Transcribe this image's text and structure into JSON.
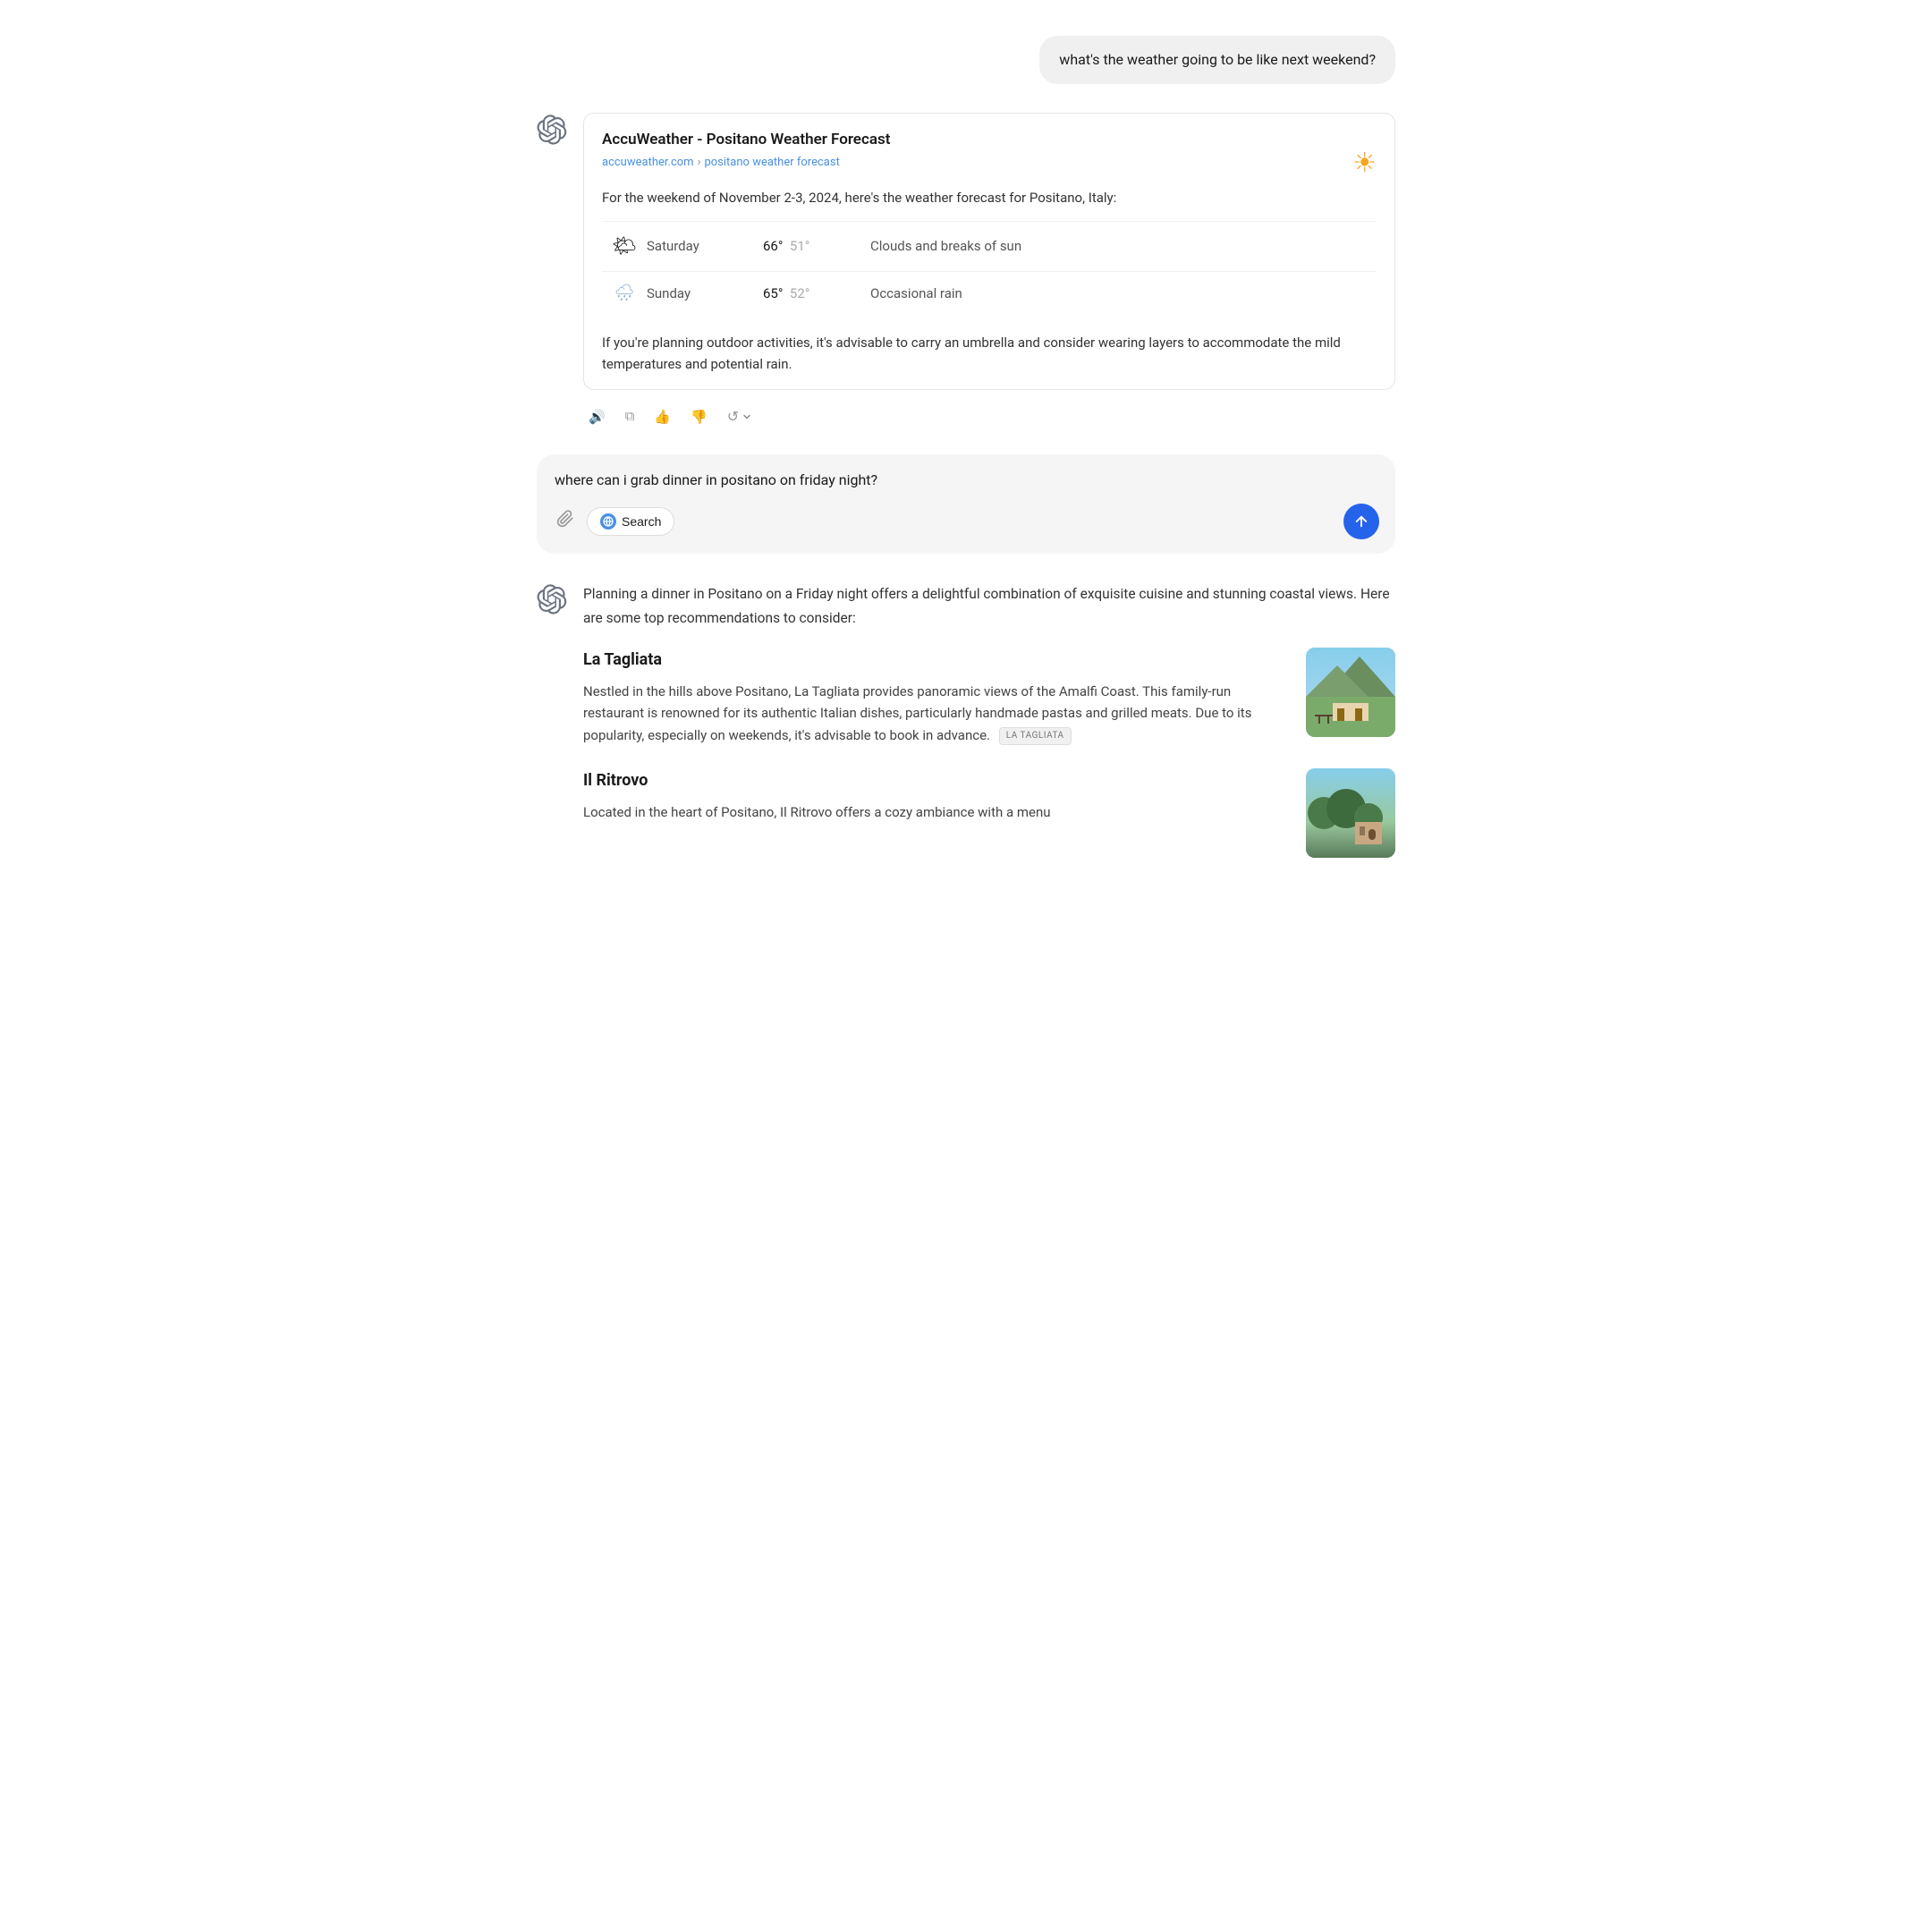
{
  "user_message_1": {
    "text": "what's the weather going to be like next weekend?"
  },
  "weather_response": {
    "card_title": "AccuWeather - Positano Weather Forecast",
    "card_url_domain": "accuweather.com",
    "card_url_separator": "›",
    "card_url_path": "positano weather forecast",
    "intro_text": "For the weekend of November 2-3, 2024, here's the weather forecast for Positano, Italy:",
    "days": [
      {
        "icon": "🌤",
        "day": "Saturday",
        "high": "66°",
        "low": "51°",
        "description": "Clouds and breaks of sun"
      },
      {
        "icon": "🌧",
        "day": "Sunday",
        "high": "65°",
        "low": "52°",
        "description": "Occasional rain"
      }
    ],
    "advice": "If you're planning outdoor activities, it's advisable to carry an umbrella and consider wearing layers to accommodate the mild temperatures and potential rain.",
    "sun_icon": "☀"
  },
  "action_bar": {
    "speaker": "🔊",
    "copy": "⧉",
    "thumbs_up": "👍",
    "thumbs_down": "👎",
    "refresh": "↺"
  },
  "input_box": {
    "text": "where can i grab dinner in positano on friday night?",
    "attach_icon": "📎",
    "search_label": "Search",
    "send_icon": "↑"
  },
  "dinner_response": {
    "intro": "Planning a dinner in Positano on a Friday night offers a delightful combination of exquisite cuisine and stunning coastal views. Here are some top recommendations to consider:",
    "restaurants": [
      {
        "name": "La Tagliata",
        "description": "Nestled in the hills above Positano, La Tagliata provides panoramic views of the Amalfi Coast. This family-run restaurant is renowned for its authentic Italian dishes, particularly handmade pastas and grilled meats. Due to its popularity, especially on weekends, it's advisable to book in advance.",
        "tag": "LA TAGLIATA"
      },
      {
        "name": "Il Ritrovo",
        "description": "Located in the heart of Positano, Il Ritrovo offers a cozy ambiance with a menu",
        "tag": null
      }
    ]
  }
}
